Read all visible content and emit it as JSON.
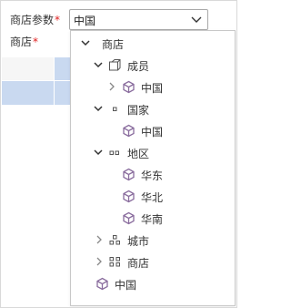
{
  "form": {
    "param_label": "商店参数",
    "param_required_mark": "*",
    "store_label": "商店",
    "store_required_mark": "*",
    "select_value": "中国"
  },
  "tree": {
    "root": "商店",
    "members": "成员",
    "members_child": "中国",
    "country": "国家",
    "country_child": "中国",
    "region": "地区",
    "region_east": "华东",
    "region_north": "华北",
    "region_south": "华南",
    "city": "城市",
    "shop": "商店",
    "china": "中国"
  },
  "colors": {
    "cube_icon": "#8a6d9e",
    "grid_blue": "#c9d9f0",
    "grid_light": "#f6f6f6",
    "required_mark": "#e02020"
  }
}
